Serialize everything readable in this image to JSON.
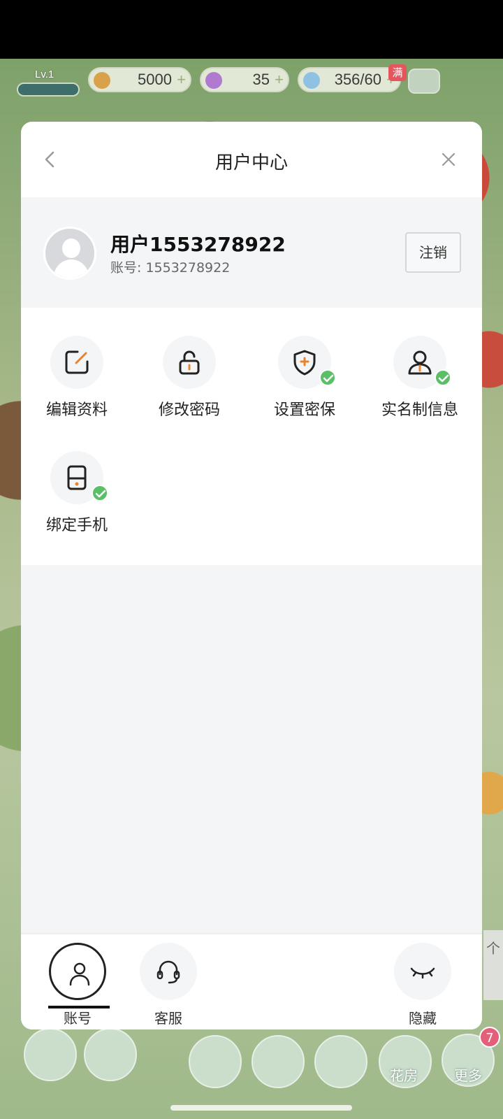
{
  "hud": {
    "level": "Lv.1",
    "coins": "5000",
    "stars": "35",
    "water": "356/60",
    "full_tag": "满",
    "right_tab": "个"
  },
  "dock": {
    "flower_house": "花房",
    "more": "更多",
    "more_badge": "7"
  },
  "modal": {
    "title": "用户中心",
    "user": {
      "name": "用户1553278922",
      "account": "账号: 1553278922",
      "logout": "注销"
    },
    "functions": [
      {
        "label": "编辑资料",
        "verified": false
      },
      {
        "label": "修改密码",
        "verified": false
      },
      {
        "label": "设置密保",
        "verified": true
      },
      {
        "label": "实名制信息",
        "verified": true
      },
      {
        "label": "绑定手机",
        "verified": true
      }
    ],
    "footer": {
      "account": "账号",
      "service": "客服",
      "hide": "隐藏"
    }
  },
  "colors": {
    "check_green": "#5bbf67",
    "accent_orange": "#e8842c"
  }
}
